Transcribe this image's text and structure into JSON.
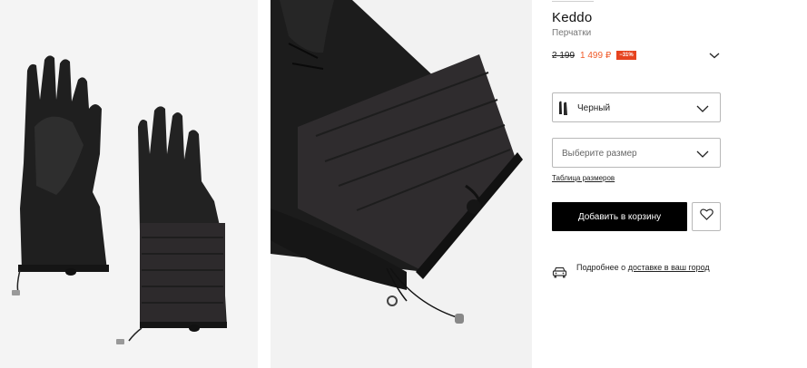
{
  "gallery": {
    "images": [
      {
        "name": "gloves-pair-photo"
      },
      {
        "name": "glove-cuff-detail-photo"
      }
    ]
  },
  "product": {
    "brand": "Keddo",
    "category": "Перчатки",
    "old_price": "2 199",
    "new_price": "1 499 ₽",
    "discount": "−31%"
  },
  "color_select": {
    "selected": "Черный",
    "icon": "chevron-down-icon"
  },
  "size_select": {
    "placeholder": "Выберите размер",
    "icon": "chevron-down-icon"
  },
  "size_table_link": "Таблица размеров",
  "add_to_cart": "Добавить в корзину",
  "favorite_icon": "heart-icon",
  "delivery": {
    "icon": "car-icon",
    "text_prefix": "Подробнее о ",
    "link_text": "доставке в ваш город"
  },
  "colors": {
    "accent_price": "#f05a28",
    "discount_badge": "#e6431f",
    "button": "#000000"
  }
}
